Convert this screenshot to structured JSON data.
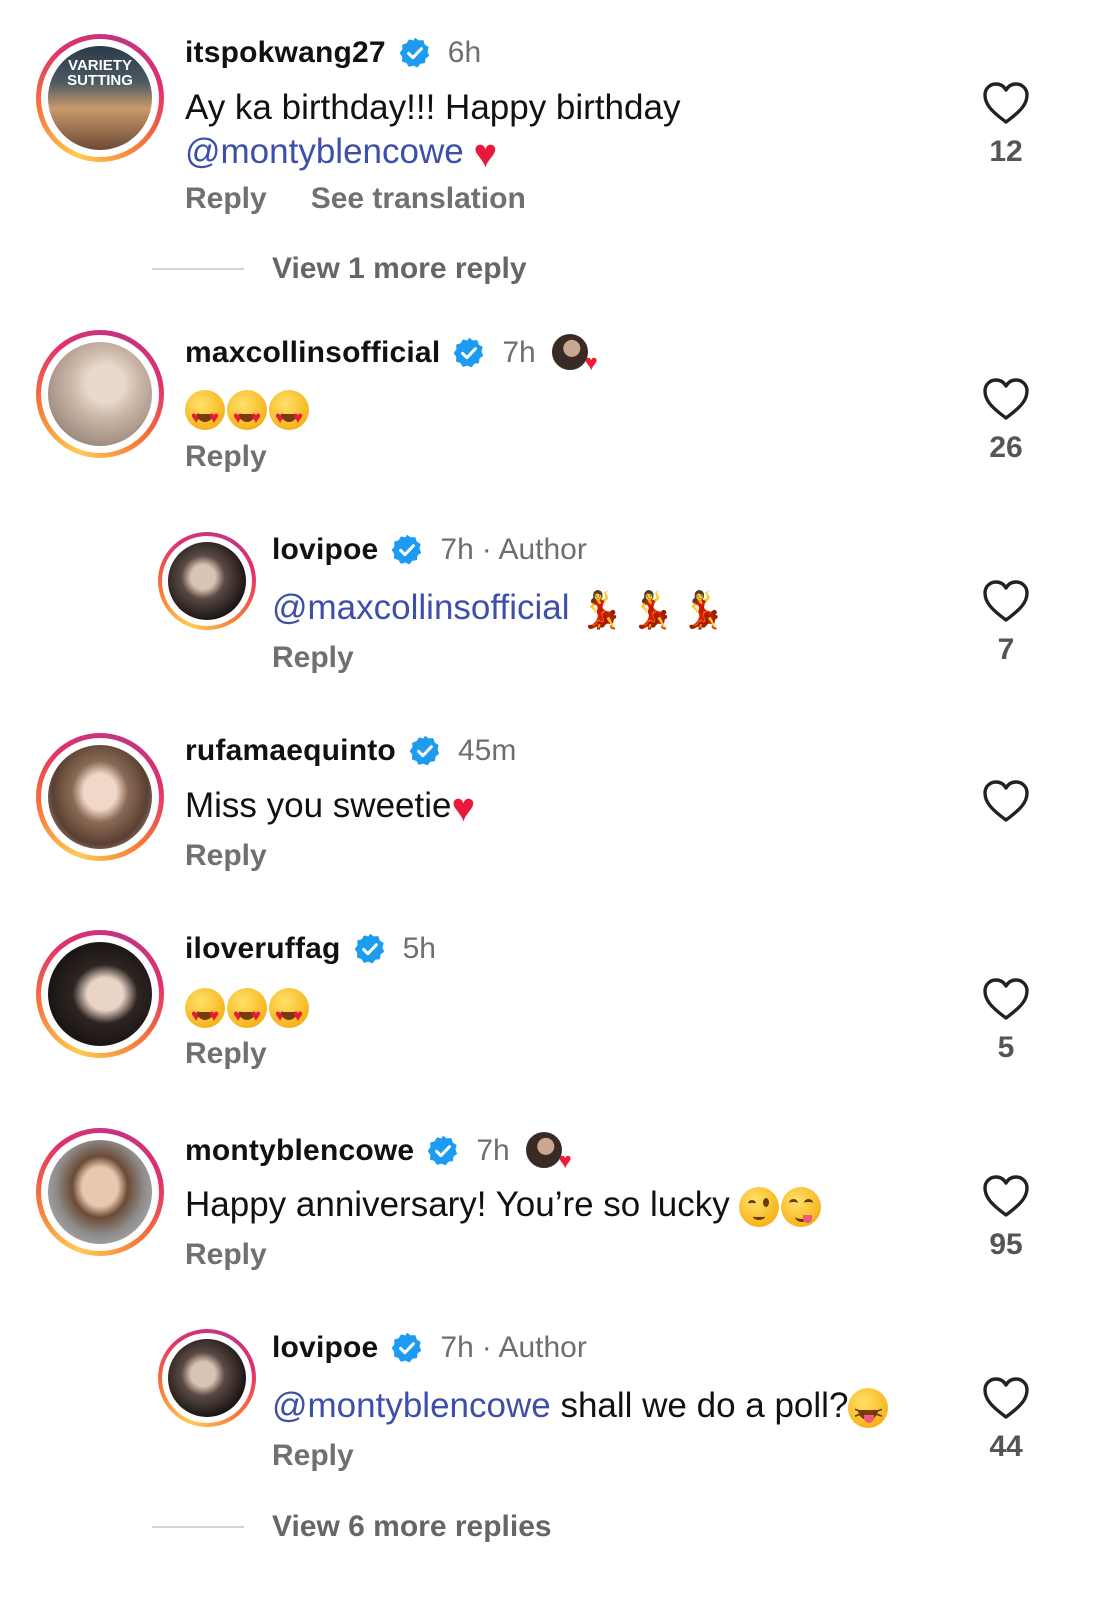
{
  "comments": [
    {
      "username": "itspokwang27",
      "time": "6h",
      "text": "Ay ka birthday!!! Happy birthday",
      "mention": "@montyblencowe",
      "reply_label": "Reply",
      "translate_label": "See translation",
      "likes": "12",
      "view_more": "View 1 more reply",
      "avatar_text": "VARIETY SUTTING"
    },
    {
      "username": "maxcollinsofficial",
      "time": "7h",
      "emojis": [
        "heart-eyes-emoji",
        "heart-eyes-emoji",
        "heart-eyes-emoji"
      ],
      "reply_label": "Reply",
      "likes": "26"
    },
    {
      "username": "lovipoe",
      "time": "7h",
      "author_label": "· Author",
      "mention": "@maxcollinsofficial",
      "emojis": [
        "dancer-emoji",
        "dancer-emoji",
        "dancer-emoji"
      ],
      "reply_label": "Reply",
      "likes": "7"
    },
    {
      "username": "rufamaequinto",
      "time": "45m",
      "text": "Miss you sweetie",
      "reply_label": "Reply"
    },
    {
      "username": "iloveruffag",
      "time": "5h",
      "emojis": [
        "heart-eyes-emoji",
        "heart-eyes-emoji",
        "heart-eyes-emoji"
      ],
      "reply_label": "Reply",
      "likes": "5"
    },
    {
      "username": "montyblencowe",
      "time": "7h",
      "text": "Happy anniversary! You’re so lucky",
      "emojis": [
        "wink-emoji",
        "yum-emoji"
      ],
      "reply_label": "Reply",
      "likes": "95"
    },
    {
      "username": "lovipoe",
      "time": "7h",
      "author_label": "· Author",
      "mention": "@montyblencowe",
      "text": " shall we do a poll?",
      "emojis": [
        "squint-tongue-emoji"
      ],
      "reply_label": "Reply",
      "likes": "44",
      "view_more": "View 6 more replies"
    }
  ],
  "colors": {
    "mention": "#3d4fa8",
    "verified": "#1d9bf0",
    "muted": "#6e6e6e",
    "story_ring": [
      "#fdcb52",
      "#e1306c",
      "#c13584"
    ]
  },
  "icons": {
    "verified": "verified-badge-icon",
    "like": "heart-outline-icon",
    "reacted_by_author": "author-heart-reaction-icon"
  }
}
